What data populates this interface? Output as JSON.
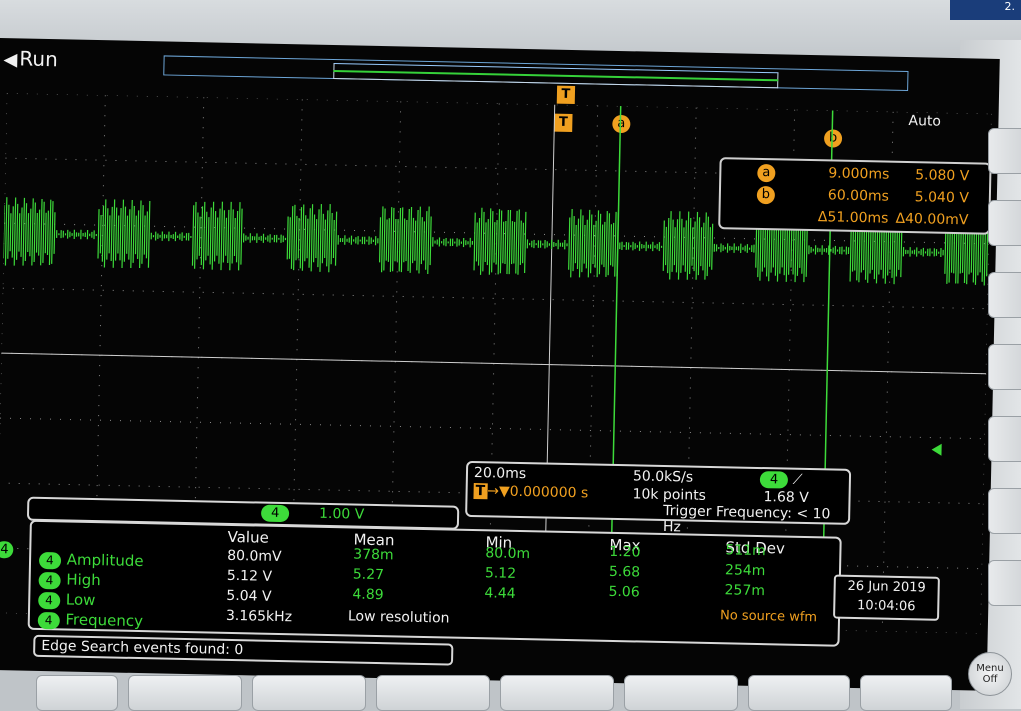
{
  "top_right_badge": "2.",
  "status": {
    "run_label": "Run",
    "trigger_mode": "Auto"
  },
  "markers": {
    "trigger": "T",
    "cursor_a": "a",
    "cursor_b": "b"
  },
  "cursors": {
    "a": {
      "label": "a",
      "time": "9.000ms",
      "volt": "5.080 V"
    },
    "b": {
      "label": "b",
      "time": "60.00ms",
      "volt": "5.040 V"
    },
    "delta": {
      "time": "Δ51.00ms",
      "volt": "Δ40.00mV"
    }
  },
  "horizontal": {
    "scale": "20.0ms",
    "sample_rate": "50.0kS/s",
    "position": "0.000000 s",
    "record_length": "10k points",
    "trigger_channel": "4",
    "trigger_slope": "⟋",
    "trigger_level": "1.68 V",
    "trigger_frequency": "Trigger Frequency: < 10 Hz"
  },
  "vertical": {
    "channel": "4",
    "scale": "1.00 V"
  },
  "measurements": {
    "headers": [
      "Value",
      "Mean",
      "Min",
      "Max",
      "Std Dev"
    ],
    "rows": [
      {
        "ch": "4",
        "name": "Amplitude",
        "value": "80.0mV",
        "mean": "378m",
        "min": "80.0m",
        "max": "1.20",
        "std": "511m"
      },
      {
        "ch": "4",
        "name": "High",
        "value": "5.12 V",
        "mean": "5.27",
        "min": "5.12",
        "max": "5.68",
        "std": "254m"
      },
      {
        "ch": "4",
        "name": "Low",
        "value": "5.04 V",
        "mean": "4.89",
        "min": "4.44",
        "max": "5.06",
        "std": "257m"
      },
      {
        "ch": "4",
        "name": "Frequency",
        "value": "3.165kHz",
        "mean": "Low resolution",
        "min": "",
        "max": "",
        "std": ""
      }
    ],
    "no_source": "No source wfm"
  },
  "datetime": {
    "date": "26 Jun 2019",
    "time": "10:04:06"
  },
  "edge_search": "Edge Search events found: 0",
  "left_channel_marker": "4",
  "menu_button": {
    "line1": "Menu",
    "line2": "Off"
  },
  "colors": {
    "trace": "#3ddb3a",
    "cursor": "#f0a020",
    "text": "#f2f2f2",
    "record_bar": "#6da6d8"
  }
}
